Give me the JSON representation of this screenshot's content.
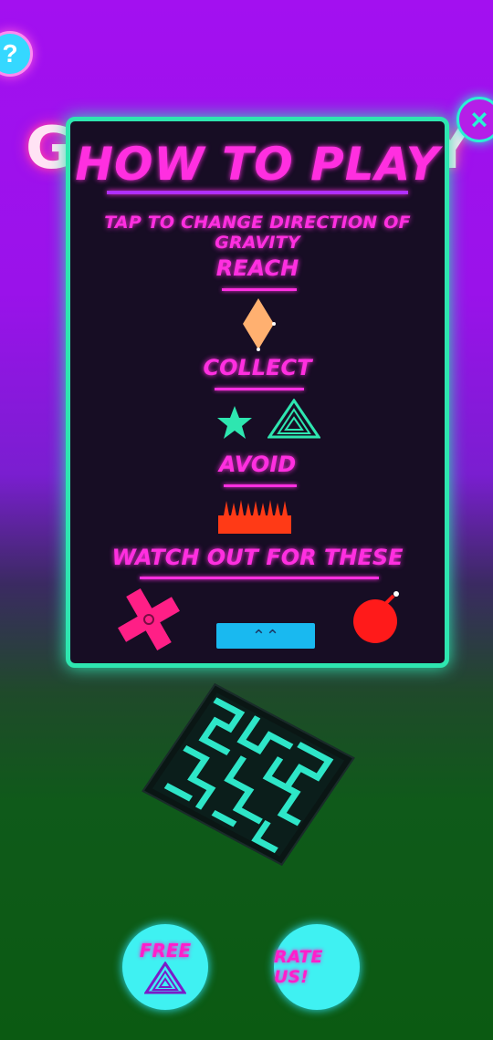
{
  "background_title": {
    "left_letter": "G",
    "right_letter": "Y"
  },
  "top_buttons": {
    "help_icon_name": "question-icon",
    "close_icon_name": "close-icon"
  },
  "dialog": {
    "title": "HOW TO PLAY",
    "subtitle": "TAP TO CHANGE DIRECTION OF GRAVITY",
    "sections": {
      "reach": "REACH",
      "collect": "COLLECT",
      "avoid": "AVOID",
      "watch_out": "WATCH OUT FOR THESE"
    },
    "icons": {
      "reach_item": "diamond-icon",
      "collect_items": [
        "star-icon",
        "triangle-icon"
      ],
      "avoid_item": "spikes-icon",
      "watch_out_items": [
        "cross-icon",
        "bomb-icon"
      ]
    },
    "colors": {
      "panel_border": "#2ee6b0",
      "neon_text": "#ff2fe0",
      "diamond": "#ffb070",
      "collectible": "#2ee6b0",
      "spikes": "#ff3a16",
      "cross": "#ff1f86",
      "bomb": "#ff1a1a"
    }
  },
  "bottom_buttons": {
    "free_label": "FREE",
    "rate_label": "RATE US!"
  }
}
